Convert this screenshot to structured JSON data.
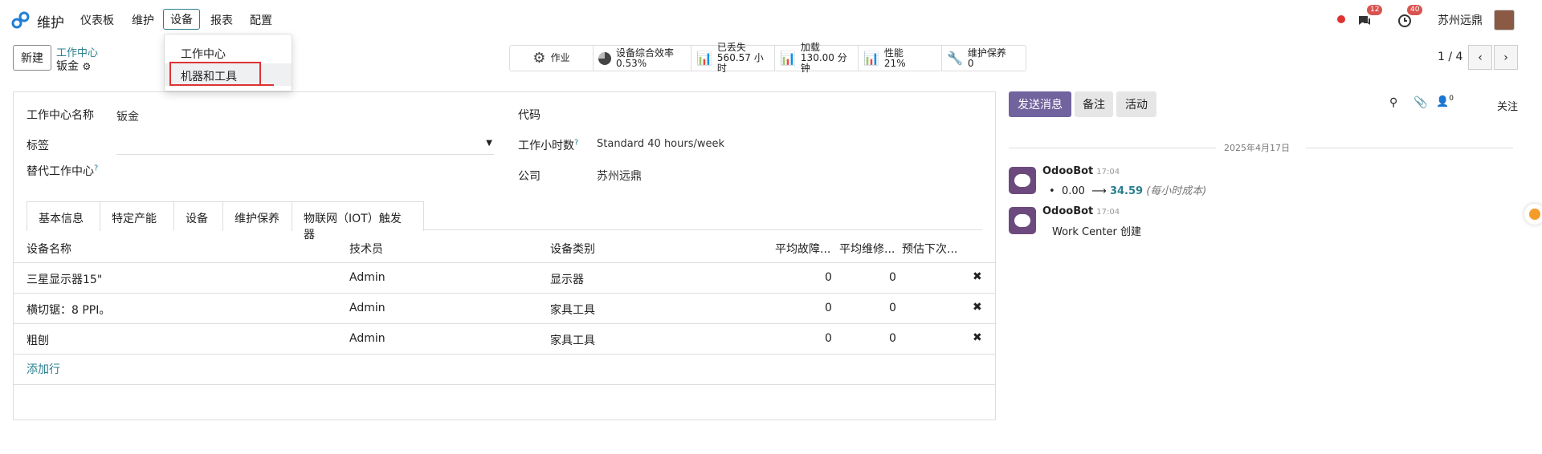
{
  "nav": {
    "app_title": "维护",
    "menus": [
      "仪表板",
      "维护",
      "设备",
      "报表",
      "配置"
    ],
    "chat_badge": "12",
    "activity_badge": "40",
    "company": "苏州远鼎"
  },
  "dropdown": {
    "items": [
      "工作中心",
      "机器和工具"
    ]
  },
  "control": {
    "new_button": "新建",
    "breadcrumb_parent": "工作中心",
    "breadcrumb_current": "钣金",
    "stats": [
      {
        "label": "作业",
        "value": "",
        "icon": "gear-icon"
      },
      {
        "label": "设备综合效率",
        "value": "0.53%",
        "icon": "pie-chart-icon"
      },
      {
        "label": "已丢失",
        "value": "560.57 小时",
        "icon": "bar-chart-icon"
      },
      {
        "label": "加载",
        "value": "130.00 分钟",
        "icon": "bar-chart-icon"
      },
      {
        "label": "性能",
        "value": "21%",
        "icon": "bar-chart-icon"
      },
      {
        "label": "维护保养",
        "value": "0",
        "icon": "wrench-icon"
      }
    ],
    "pager": "1 / 4"
  },
  "form": {
    "name_label": "工作中心名称",
    "name_value": "钣金",
    "tag_label": "标签",
    "alt_label": "替代工作中心",
    "code_label": "代码",
    "hours_label": "工作小时数",
    "hours_value": "Standard 40 hours/week",
    "company_label": "公司",
    "company_value": "苏州远鼎",
    "help_mark": "?"
  },
  "tabs": [
    "基本信息",
    "特定产能",
    "设备",
    "维护保养",
    "物联网（IOT）触发器"
  ],
  "table": {
    "headers": [
      "设备名称",
      "技术员",
      "设备类别",
      "平均故障...",
      "平均维修...",
      "预估下次..."
    ],
    "rows": [
      {
        "name": "三星显示器15\"",
        "tech": "Admin",
        "category": "显示器",
        "mtbf": "0",
        "mttr": "0"
      },
      {
        "name": "横切锯：8 PPI。",
        "tech": "Admin",
        "category": "家具工具",
        "mtbf": "0",
        "mttr": "0"
      },
      {
        "name": "粗刨",
        "tech": "Admin",
        "category": "家具工具",
        "mtbf": "0",
        "mttr": "0"
      }
    ],
    "add_row": "添加行"
  },
  "chatter": {
    "send_message": "发送消息",
    "note": "备注",
    "activity": "活动",
    "followers_count": "0",
    "follow": "关注",
    "date": "2025年4月17日",
    "messages": [
      {
        "author": "OdooBot",
        "time": "17:04",
        "old": "0.00",
        "new": "34.59",
        "field": "(每小时成本)"
      },
      {
        "author": "OdooBot",
        "time": "17:04",
        "text": "Work Center 创建"
      }
    ]
  },
  "colors": {
    "accent": "#71639e",
    "teal": "#2a7f8e",
    "highlight": "#dd3333"
  }
}
